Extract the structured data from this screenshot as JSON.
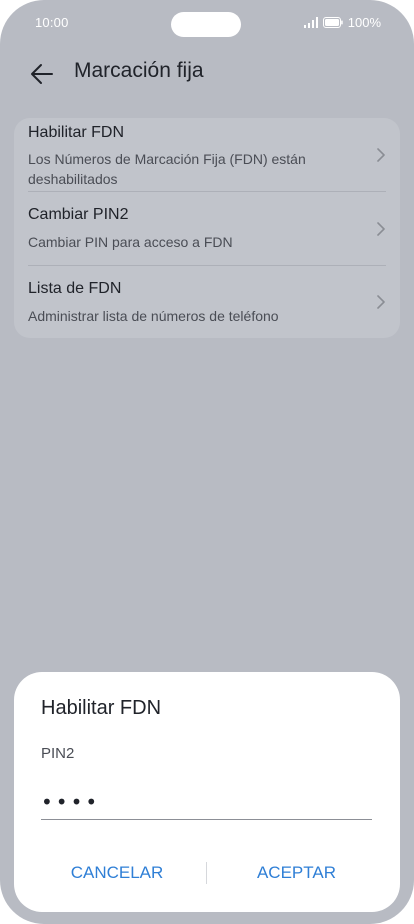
{
  "status_bar": {
    "time": "10:00",
    "battery": "100%",
    "icons": [
      "signal-icon",
      "battery-icon"
    ]
  },
  "header": {
    "title": "Marcación fija",
    "back_icon": "back-arrow-icon"
  },
  "list": {
    "items": [
      {
        "title": "Habilitar FDN",
        "subtitle": "Los Números de Marcación Fija (FDN) están deshabilitados"
      },
      {
        "title": "Cambiar PIN2",
        "subtitle": "Cambiar PIN para acceso a FDN"
      },
      {
        "title": "Lista de FDN",
        "subtitle": "Administrar lista de números de teléfono"
      }
    ]
  },
  "dialog": {
    "title": "Habilitar FDN",
    "field_label": "PIN2",
    "pin_value": "••••",
    "cancel_label": "CANCELAR",
    "accept_label": "ACEPTAR"
  },
  "colors": {
    "accent": "#2f7fd6",
    "scrim": "#b8bbc3",
    "card": "#c1c4cb"
  }
}
